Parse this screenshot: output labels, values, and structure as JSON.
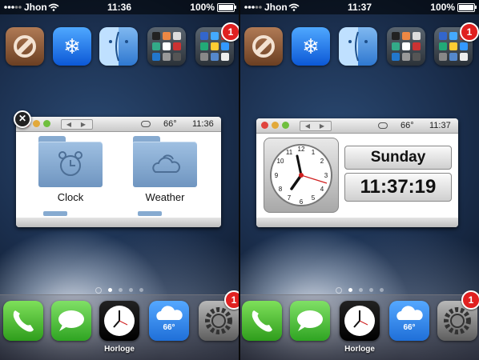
{
  "left": {
    "status": {
      "carrier": "Jhon",
      "time": "11:36",
      "battery": "100%"
    },
    "top_badge": "1",
    "widget": {
      "temperature": "66°",
      "time": "11:36",
      "folders": [
        {
          "label": "Clock"
        },
        {
          "label": "Weather"
        }
      ]
    },
    "dock": {
      "clock_label": "Horloge",
      "weather_temp": "66°",
      "settings_badge": "1"
    }
  },
  "right": {
    "status": {
      "carrier": "Jhon",
      "time": "11:37",
      "battery": "100%"
    },
    "top_badge": "1",
    "widget": {
      "temperature": "66°",
      "time": "11:37",
      "day": "Sunday",
      "digital_time": "11:37:19"
    },
    "dock": {
      "clock_label": "Horloge",
      "weather_temp": "66°",
      "settings_badge": "1"
    }
  },
  "page_dots": {
    "count": 4,
    "active": 0
  },
  "icons": {
    "row": [
      "cydia-icon",
      "snowflake-icon",
      "finder-icon",
      "folder-icon",
      "folder-icon"
    ],
    "dock": [
      "phone-icon",
      "messages-icon",
      "clock-icon",
      "weather-icon",
      "settings-icon"
    ]
  },
  "colors": {
    "badge": "#e02020",
    "wallpaper": "#1b2f4e",
    "widget_bar": "#d8d8d8",
    "digital_hand_red": "#d02020"
  }
}
